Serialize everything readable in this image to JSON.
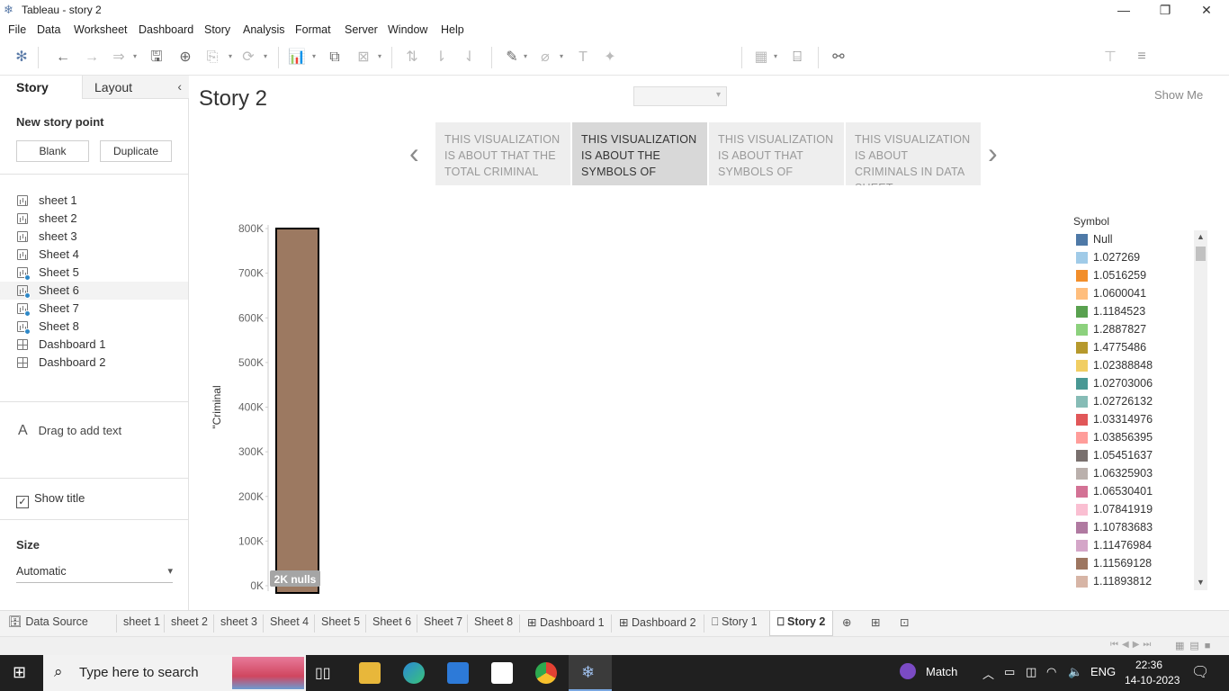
{
  "window": {
    "title": "Tableau - story 2"
  },
  "menu": [
    "File",
    "Data",
    "Worksheet",
    "Dashboard",
    "Story",
    "Analysis",
    "Format",
    "Server",
    "Window",
    "Help"
  ],
  "toolbar": {
    "show_me": "Show Me"
  },
  "sidebar": {
    "tab_story": "Story",
    "tab_layout": "Layout",
    "new_story_point": "New story point",
    "btn_blank": "Blank",
    "btn_duplicate": "Duplicate",
    "sheets": [
      {
        "label": "sheet 1",
        "type": "worksheet",
        "used": false
      },
      {
        "label": "sheet 2",
        "type": "worksheet",
        "used": false
      },
      {
        "label": "sheet 3",
        "type": "worksheet",
        "used": false
      },
      {
        "label": "Sheet 4",
        "type": "worksheet",
        "used": false
      },
      {
        "label": "Sheet 5",
        "type": "worksheet",
        "used": true
      },
      {
        "label": "Sheet 6",
        "type": "worksheet",
        "used": true
      },
      {
        "label": "Sheet 7",
        "type": "worksheet",
        "used": true
      },
      {
        "label": "Sheet 8",
        "type": "worksheet",
        "used": true
      },
      {
        "label": "Dashboard 1",
        "type": "dashboard",
        "used": false
      },
      {
        "label": "Dashboard 2",
        "type": "dashboard",
        "used": false
      }
    ],
    "drag_text": "Drag to add text",
    "show_title": "Show title",
    "size_label": "Size",
    "size_value": "Automatic"
  },
  "story": {
    "title": "Story 2",
    "points": [
      {
        "text": "THIS VISUALIZATION IS ABOUT THAT THE TOTAL CRIMINAL",
        "active": false
      },
      {
        "text": "THIS VISUALIZATION IS ABOUT THE SYMBOLS OF",
        "active": true
      },
      {
        "text": "THIS VISUALIZATION IS ABOUT THAT SYMBOLS OF",
        "active": false
      },
      {
        "text": "THIS VISUALIZATION IS ABOUT CRIMINALS IN DATA SHEET",
        "active": false
      }
    ]
  },
  "chart_data": {
    "type": "bar",
    "categories": [
      ""
    ],
    "values": [
      800000
    ],
    "bar_color": "#9c7961",
    "ylabel": "\"Criminal",
    "ylim": [
      0,
      800000
    ],
    "y_ticks": [
      "0K",
      "100K",
      "200K",
      "300K",
      "400K",
      "500K",
      "600K",
      "700K",
      "800K"
    ],
    "y_tick_values": [
      0,
      100000,
      200000,
      300000,
      400000,
      500000,
      600000,
      700000,
      800000
    ],
    "nulls_indicator": "2K nulls",
    "legend_title": "Symbol",
    "legend": [
      {
        "label": "Null",
        "color": "#4e79a7"
      },
      {
        "label": "1.027269",
        "color": "#a0cbe8"
      },
      {
        "label": "1.0516259",
        "color": "#f28e2b"
      },
      {
        "label": "1.0600041",
        "color": "#ffbe7d"
      },
      {
        "label": "1.1184523",
        "color": "#59a14f"
      },
      {
        "label": "1.2887827",
        "color": "#8cd17d"
      },
      {
        "label": "1.4775486",
        "color": "#b6992d"
      },
      {
        "label": "1.02388848",
        "color": "#f1ce63"
      },
      {
        "label": "1.02703006",
        "color": "#499894"
      },
      {
        "label": "1.02726132",
        "color": "#86bcb6"
      },
      {
        "label": "1.03314976",
        "color": "#e15759"
      },
      {
        "label": "1.03856395",
        "color": "#ff9d9a"
      },
      {
        "label": "1.05451637",
        "color": "#79706e"
      },
      {
        "label": "1.06325903",
        "color": "#bab0ac"
      },
      {
        "label": "1.06530401",
        "color": "#d37295"
      },
      {
        "label": "1.07841919",
        "color": "#fabfd2"
      },
      {
        "label": "1.10783683",
        "color": "#b07aa1"
      },
      {
        "label": "1.11476984",
        "color": "#d4a6c8"
      },
      {
        "label": "1.11569128",
        "color": "#9d7660"
      },
      {
        "label": "1.11893812",
        "color": "#d7b5a6"
      }
    ]
  },
  "tabs": [
    {
      "label": "Data Source",
      "icon": "database-icon"
    },
    {
      "label": "sheet 1"
    },
    {
      "label": "sheet 2"
    },
    {
      "label": "sheet 3"
    },
    {
      "label": "Sheet 4"
    },
    {
      "label": "Sheet 5"
    },
    {
      "label": "Sheet 6"
    },
    {
      "label": "Sheet 7"
    },
    {
      "label": "Sheet 8"
    },
    {
      "label": "Dashboard 1",
      "icon": "dashboard-icon"
    },
    {
      "label": "Dashboard 2",
      "icon": "dashboard-icon"
    },
    {
      "label": "Story 1",
      "icon": "story-icon"
    },
    {
      "label": "Story 2",
      "icon": "story-icon",
      "active": true
    }
  ],
  "taskbar": {
    "search_placeholder": "Type here to search",
    "weather": "Match",
    "lang": "ENG",
    "time": "22:36",
    "date": "14-10-2023"
  }
}
